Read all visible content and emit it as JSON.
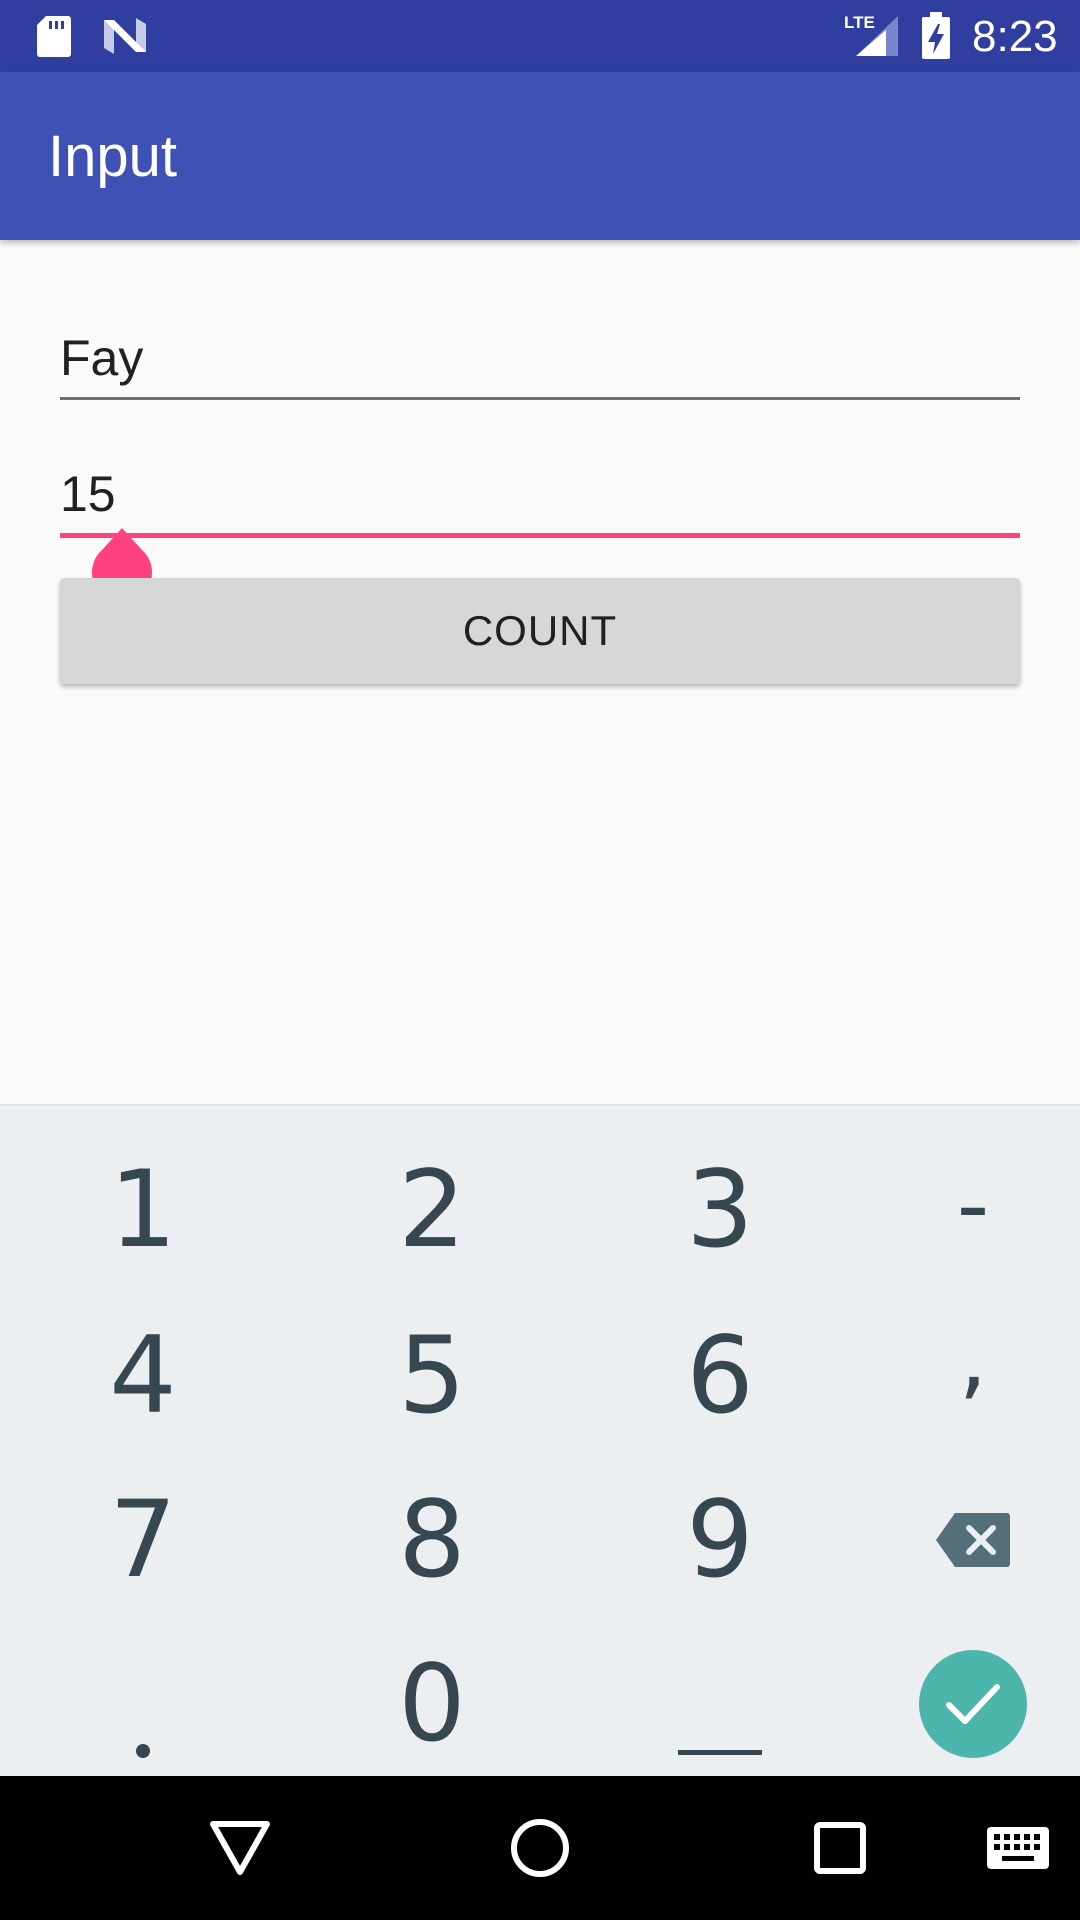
{
  "status_bar": {
    "time": "8:23",
    "icons": [
      "sd-card-icon",
      "n-logo-icon",
      "lte-signal-icon",
      "battery-charging-icon"
    ],
    "network_label": "LTE"
  },
  "app_bar": {
    "title": "Input"
  },
  "form": {
    "name_value": "Fay",
    "count_value": "15",
    "count_button_label": "COUNT"
  },
  "keyboard": {
    "rows": [
      [
        "1",
        "2",
        "3",
        "-"
      ],
      [
        "4",
        "5",
        "6",
        ","
      ],
      [
        "7",
        "8",
        "9",
        "backspace-icon"
      ],
      [
        ".",
        "0",
        "space-icon",
        "done-icon"
      ]
    ]
  },
  "nav_bar": {
    "icons": [
      "back-icon",
      "home-icon",
      "recents-icon",
      "keyboard-switch-icon"
    ]
  },
  "colors": {
    "status_bar": "#303f9f",
    "app_bar": "#3f51b5",
    "accent": "#ff4081",
    "done_key": "#4db6ac",
    "key_text": "#37474f",
    "keyboard_bg": "#eceff1"
  }
}
